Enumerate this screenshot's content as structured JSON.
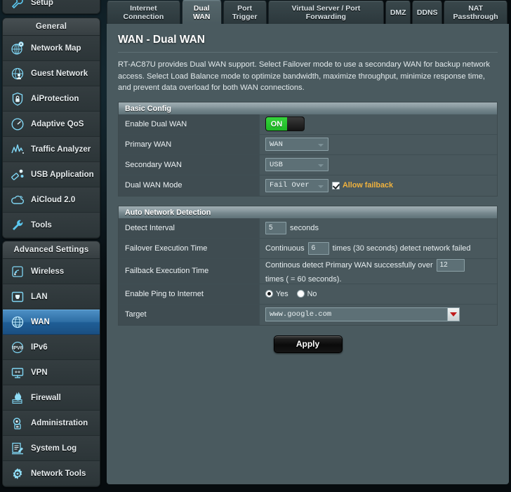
{
  "sidebar": {
    "setup_label": "Setup",
    "general_header": "General",
    "general_items": [
      {
        "label": "Network Map",
        "icon": "network-map-icon"
      },
      {
        "label": "Guest Network",
        "icon": "guest-network-icon"
      },
      {
        "label": "AiProtection",
        "icon": "shield-icon"
      },
      {
        "label": "Adaptive QoS",
        "icon": "gauge-icon"
      },
      {
        "label": "Traffic Analyzer",
        "icon": "traffic-chart-icon"
      },
      {
        "label": "USB Application",
        "icon": "usb-icon"
      },
      {
        "label": "AiCloud 2.0",
        "icon": "cloud-icon"
      },
      {
        "label": "Tools",
        "icon": "wrench-icon"
      }
    ],
    "advanced_header": "Advanced Settings",
    "advanced_items": [
      {
        "label": "Wireless",
        "icon": "wifi-icon",
        "active": false
      },
      {
        "label": "LAN",
        "icon": "lan-port-icon",
        "active": false
      },
      {
        "label": "WAN",
        "icon": "globe-icon",
        "active": true
      },
      {
        "label": "IPv6",
        "icon": "ipv6-icon",
        "active": false
      },
      {
        "label": "VPN",
        "icon": "vpn-monitor-icon",
        "active": false
      },
      {
        "label": "Firewall",
        "icon": "firewall-flame-icon",
        "active": false
      },
      {
        "label": "Administration",
        "icon": "administration-gear-icon",
        "active": false
      },
      {
        "label": "System Log",
        "icon": "system-log-icon",
        "active": false
      },
      {
        "label": "Network Tools",
        "icon": "network-tools-gear-icon",
        "active": false
      }
    ]
  },
  "tabs": [
    {
      "line1": "Internet",
      "line2": "Connection",
      "active": false
    },
    {
      "line1": "Dual",
      "line2": "WAN",
      "active": true
    },
    {
      "line1": "Port",
      "line2": "Trigger",
      "active": false
    },
    {
      "line1": "Virtual Server / Port",
      "line2": "Forwarding",
      "active": false
    },
    {
      "line1": "DMZ",
      "line2": "",
      "active": false
    },
    {
      "line1": "DDNS",
      "line2": "",
      "active": false
    },
    {
      "line1": "NAT",
      "line2": "Passthrough",
      "active": false
    }
  ],
  "page": {
    "title": "WAN - Dual WAN",
    "description": "RT-AC87U provides Dual WAN support. Select Failover mode to use a secondary WAN for backup network access. Select Load Balance mode to optimize bandwidth, maximize throughput, minimize response time, and prevent data overload for both WAN connections."
  },
  "basic_config": {
    "header": "Basic Config",
    "enable_dual_wan": {
      "label": "Enable Dual WAN",
      "state": "ON"
    },
    "primary_wan": {
      "label": "Primary WAN",
      "value": "WAN"
    },
    "secondary_wan": {
      "label": "Secondary WAN",
      "value": "USB"
    },
    "dual_wan_mode": {
      "label": "Dual WAN Mode",
      "value": "Fail Over",
      "checkbox_label": "Allow failback",
      "checked": true
    }
  },
  "auto_network_detection": {
    "header": "Auto Network Detection",
    "detect_interval": {
      "label": "Detect Interval",
      "value": "5",
      "unit": "seconds"
    },
    "failover": {
      "label": "Failover Execution Time",
      "prefix": "Continuous",
      "value": "6",
      "suffix": "times (30  seconds) detect network failed"
    },
    "failback": {
      "label": "Failback Execution Time",
      "prefix": "Continous detect Primary WAN successfully over",
      "value": "12",
      "suffix": "times ( = 60  seconds)."
    },
    "ping": {
      "label": "Enable Ping to Internet",
      "yes_label": "Yes",
      "no_label": "No",
      "selected": "Yes"
    },
    "target": {
      "label": "Target",
      "value": "www.google.com"
    }
  },
  "apply_label": "Apply",
  "colors": {
    "panel_bg": "#4a5a5f",
    "row_bg": "#49585d",
    "label_bg": "#3f4c51",
    "accent_orange": "#f2b33d",
    "toggle_on_green": "#1eb825",
    "active_nav_blue": "#2e6ea5",
    "icon_blue": "#5bc8f0"
  }
}
